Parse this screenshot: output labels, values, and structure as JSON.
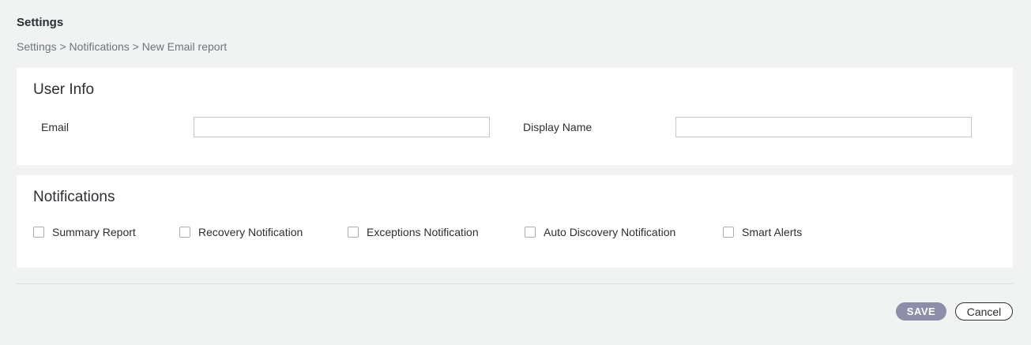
{
  "header": {
    "title": "Settings",
    "breadcrumb": "Settings > Notifications > New Email report"
  },
  "user_info": {
    "title": "User Info",
    "email_label": "Email",
    "email_value": "",
    "display_name_label": "Display Name",
    "display_name_value": ""
  },
  "notifications": {
    "title": "Notifications",
    "options": [
      {
        "label": "Summary Report",
        "checked": false
      },
      {
        "label": "Recovery Notification",
        "checked": false
      },
      {
        "label": "Exceptions Notification",
        "checked": false
      },
      {
        "label": "Auto Discovery Notification",
        "checked": false
      },
      {
        "label": "Smart Alerts",
        "checked": false
      }
    ]
  },
  "actions": {
    "save_label": "SAVE",
    "cancel_label": "Cancel"
  },
  "colors": {
    "background": "#f1f2f2",
    "card": "#ffffff",
    "save_button": "#8d8fa8",
    "breadcrumb_text": "#6d747c"
  }
}
